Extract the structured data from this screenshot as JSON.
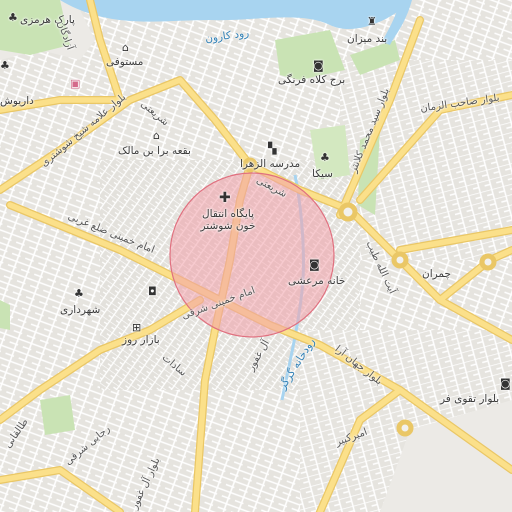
{
  "map": {
    "colors": {
      "background": "#f2f1ee",
      "river": "#a8d4f0",
      "park": "#c9e3b4",
      "arterial": "#fbe08a",
      "arterial_edge": "#eac766",
      "street": "#ffffff",
      "highlight_fill": "#f2a0aa",
      "highlight_stroke": "#e0707f"
    },
    "labels": {
      "park_hormozi": "پارک هرمزی",
      "mostofi": "مستوفی",
      "daryush": "داریوش",
      "boqee": "بقعه برا بن مالک",
      "madrese_zahra": "مدرسه الزهرا",
      "sika": "سیکا",
      "band_mizan": "بند میزان",
      "borj": "برج کلاه فرنگی",
      "blood_center": "پایگاه انتقال خون شوشتر",
      "khaneh_marashi": "خانه مرعشی",
      "shahrdari": "شهرداری",
      "bazar_rooz": "بازار روز",
      "amir_kabir": "امیرکبیر",
      "taghavi": "بلوار تقوی فر",
      "chamran": "چمران"
    },
    "road_labels": {
      "azadegan": "آزادگان",
      "allameh": "بلوار علامه شیخ شوشتری",
      "shariati_1": "شریعتی",
      "shariati_2": "شریعتی",
      "sahebozaman": "بلوار صاحب الزمان",
      "seyed_mohammad": "بلوار سید محمد کلانتر",
      "ayatollah_taleghani": "آیت الله طیب",
      "khomeini_gharbi": "امام خمینی ضلع غربی",
      "khomeini_sharghi": "امام خمینی شرقی",
      "al_ghafour": "آل غفور",
      "sadat": "سادات",
      "jahan_ara": "بلوار جهان آرا",
      "taleghani": "طالقانی",
      "rajaei": "رجایی شرقی",
      "bolvar_al_ghafour": "بلوار آل غفور"
    },
    "water_labels": {
      "karun": "رود کارون",
      "gargar": "رودخانه گرگر"
    },
    "icons": [
      "tree-icon",
      "camera-icon",
      "museum-icon",
      "shopping-bag-icon",
      "cart-icon",
      "hospital-cross-icon",
      "school-icon"
    ]
  }
}
